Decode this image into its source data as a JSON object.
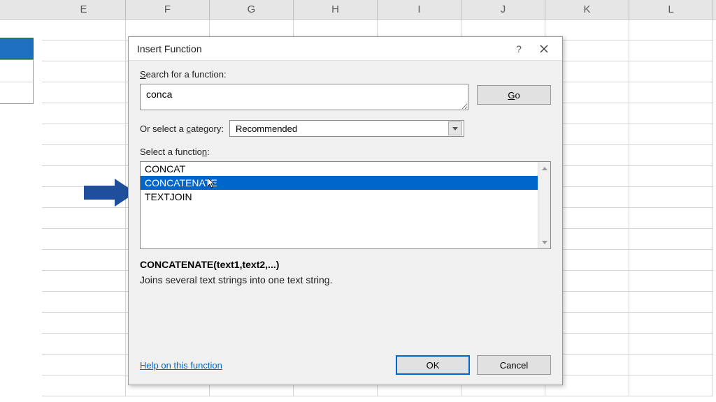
{
  "columns": [
    "E",
    "F",
    "G",
    "H",
    "I",
    "J",
    "K",
    "L"
  ],
  "dialog": {
    "title": "Insert Function",
    "search_label_pre": "S",
    "search_label_rest": "earch for a function:",
    "search_value": "conca",
    "go_pre": "G",
    "go_rest": "o",
    "category_label_pre": "Or select a ",
    "category_label_u": "c",
    "category_label_rest": "ategory:",
    "category_value": "Recommended",
    "select_fn_label_pre": "Select a functio",
    "select_fn_label_u": "n",
    "select_fn_label_rest": ":",
    "functions": [
      "CONCAT",
      "CONCATENATE",
      "TEXTJOIN"
    ],
    "selected_index": 1,
    "syntax": "CONCATENATE(text1,text2,...)",
    "description": "Joins several text strings into one text string.",
    "help_link": "Help on this function",
    "ok": "OK",
    "cancel": "Cancel"
  }
}
